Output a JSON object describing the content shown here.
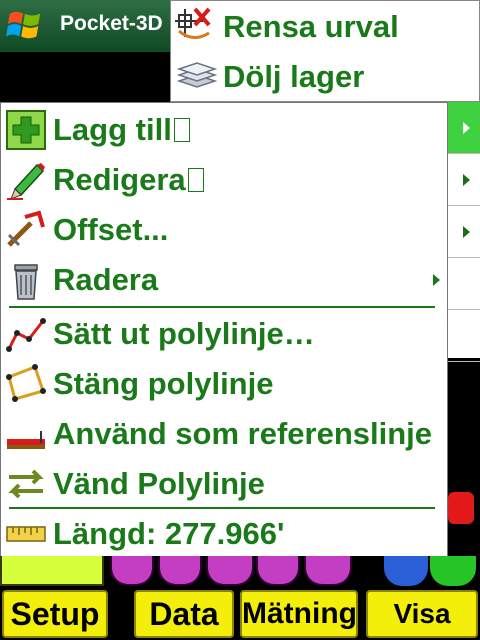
{
  "titlebar": {
    "app_title": "Pocket-3D"
  },
  "top_menu": {
    "items": [
      {
        "label": "Rensa urval",
        "icon": "clear-selection-icon"
      },
      {
        "label": "Dölj lager",
        "icon": "hide-layers-icon"
      }
    ]
  },
  "main_menu": {
    "items": [
      {
        "label": "Lagg till",
        "icon": "add-plus-icon"
      },
      {
        "label": "Redigera",
        "icon": "pencil-icon"
      },
      {
        "label": "Offset...",
        "icon": "offset-icon"
      },
      {
        "label": "Radera",
        "icon": "trash-icon"
      },
      {
        "label": "Sätt ut polylinje…",
        "icon": "polyline-icon"
      },
      {
        "label": "Stäng polylinje",
        "icon": "close-polyline-icon"
      },
      {
        "label": "Använd som referenslinje",
        "icon": "reference-line-icon"
      },
      {
        "label": "Vänd Polylinje",
        "icon": "reverse-arrows-icon"
      },
      {
        "label": "Längd: 277.966'",
        "icon": "ruler-icon"
      }
    ]
  },
  "softkeys": {
    "setup": "Setup",
    "data": "Data",
    "matning": "Mätning",
    "visa": "Visa"
  },
  "colors": {
    "menu_text": "#1a7a1a",
    "softkey_bg": "#f4ef0a",
    "title_bg": "#1f5a35",
    "highlight": "#3fd13f"
  }
}
